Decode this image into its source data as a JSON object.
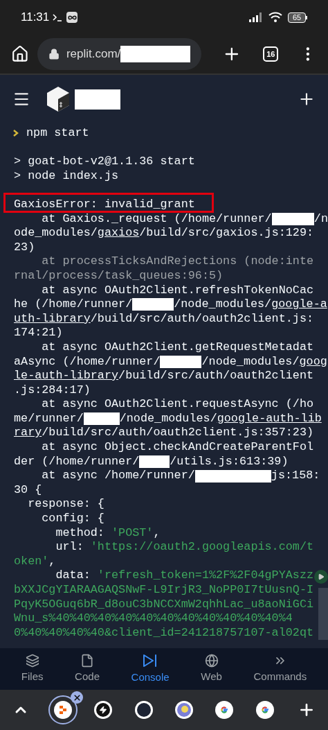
{
  "status_bar": {
    "time": "11:31",
    "battery": "65"
  },
  "browser": {
    "url": "replit.com/",
    "tab_count": "16"
  },
  "console": {
    "blocks": [
      {
        "lines": [
          {
            "kind": "prompt",
            "segments": [
              {
                "kind": "text",
                "text": "npm start"
              }
            ]
          }
        ]
      },
      {
        "lines": [
          {
            "kind": "output",
            "segments": [
              {
                "kind": "text",
                "text": "> goat-bot-v2@1.1.36 start"
              }
            ]
          },
          {
            "kind": "output",
            "segments": [
              {
                "kind": "text",
                "text": "> node index.js"
              }
            ]
          }
        ]
      },
      {
        "lines": [
          {
            "kind": "output",
            "highlighted": true,
            "segments": [
              {
                "kind": "text",
                "text": "GaxiosError: invalid_grant"
              }
            ]
          },
          {
            "kind": "output",
            "segments": [
              {
                "kind": "text",
                "text": "    at Gaxios._request (/home/runner/"
              },
              {
                "kind": "redacted"
              },
              {
                "kind": "text",
                "text": "/n"
              }
            ]
          },
          {
            "kind": "output",
            "segments": [
              {
                "kind": "text",
                "text": "ode_modules/"
              },
              {
                "kind": "link",
                "text": "gaxios"
              },
              {
                "kind": "text",
                "text": "/build/src/gaxios.js:129:"
              }
            ]
          },
          {
            "kind": "output",
            "segments": [
              {
                "kind": "text",
                "text": "23)"
              }
            ]
          },
          {
            "kind": "output",
            "segments": [
              {
                "kind": "dim",
                "text": "    at processTicksAndRejections (node:inte"
              }
            ]
          },
          {
            "kind": "output",
            "segments": [
              {
                "kind": "dim",
                "text": "rnal/process/task_queues:96:5)"
              }
            ]
          },
          {
            "kind": "output",
            "segments": [
              {
                "kind": "text",
                "text": "    at async OAuth2Client.refreshTokenNoCac"
              }
            ]
          },
          {
            "kind": "output",
            "segments": [
              {
                "kind": "text",
                "text": "he (/home/runner/"
              },
              {
                "kind": "redacted"
              },
              {
                "kind": "text",
                "text": "/node_modules/"
              },
              {
                "kind": "link",
                "text": "google-a"
              }
            ]
          },
          {
            "kind": "output",
            "segments": [
              {
                "kind": "link",
                "text": "uth-library"
              },
              {
                "kind": "text",
                "text": "/build/src/auth/oauth2client.js:"
              }
            ]
          },
          {
            "kind": "output",
            "segments": [
              {
                "kind": "text",
                "text": "174:21)"
              }
            ]
          },
          {
            "kind": "output",
            "segments": [
              {
                "kind": "text",
                "text": "    at async OAuth2Client.getRequestMetadat"
              }
            ]
          },
          {
            "kind": "output",
            "segments": [
              {
                "kind": "text",
                "text": "aAsync (/home/runner/"
              },
              {
                "kind": "redacted"
              },
              {
                "kind": "text",
                "text": "/node_modules/"
              },
              {
                "kind": "link",
                "text": "goog"
              }
            ]
          },
          {
            "kind": "output",
            "segments": [
              {
                "kind": "link",
                "text": "le-auth-library"
              },
              {
                "kind": "text",
                "text": "/build/src/auth/oauth2client"
              }
            ]
          },
          {
            "kind": "output",
            "segments": [
              {
                "kind": "text",
                "text": ".js:284:17)"
              }
            ]
          },
          {
            "kind": "output",
            "segments": [
              {
                "kind": "text",
                "text": "    at async OAuth2Client.requestAsync (/ho"
              }
            ]
          },
          {
            "kind": "output",
            "segments": [
              {
                "kind": "text",
                "text": "me/runner/"
              },
              {
                "kind": "redacted"
              },
              {
                "kind": "text",
                "text": "/node_modules/"
              },
              {
                "kind": "link",
                "text": "google-auth-lib"
              }
            ]
          },
          {
            "kind": "output",
            "segments": [
              {
                "kind": "link",
                "text": "rary"
              },
              {
                "kind": "text",
                "text": "/build/src/auth/oauth2client.js:357:23)"
              }
            ]
          },
          {
            "kind": "output",
            "segments": [
              {
                "kind": "text",
                "text": "    at async Object.checkAndCreateParentFol"
              }
            ]
          },
          {
            "kind": "output",
            "segments": [
              {
                "kind": "text",
                "text": "der (/home/runner/"
              },
              {
                "kind": "redacted"
              },
              {
                "kind": "text",
                "text": "/utils.js:613:39)"
              }
            ]
          },
          {
            "kind": "output",
            "segments": [
              {
                "kind": "text",
                "text": "    at async /home/runner/"
              },
              {
                "kind": "redacted"
              },
              {
                "kind": "text",
                "text": "js:158:"
              }
            ]
          },
          {
            "kind": "output",
            "segments": [
              {
                "kind": "text",
                "text": "30 {"
              }
            ]
          },
          {
            "kind": "output",
            "segments": [
              {
                "kind": "text",
                "text": "  response: {"
              }
            ]
          },
          {
            "kind": "output",
            "segments": [
              {
                "kind": "text",
                "text": "    config: {"
              }
            ]
          },
          {
            "kind": "output",
            "segments": [
              {
                "kind": "text",
                "text": "      method: "
              },
              {
                "kind": "string",
                "text": "'POST'"
              },
              {
                "kind": "text",
                "text": ","
              }
            ]
          },
          {
            "kind": "output",
            "segments": [
              {
                "kind": "text",
                "text": "      url: "
              },
              {
                "kind": "string",
                "text": "'https://oauth2.googleapis.com/t"
              }
            ]
          },
          {
            "kind": "output",
            "segments": [
              {
                "kind": "string",
                "text": "oken'"
              },
              {
                "kind": "text",
                "text": ","
              }
            ]
          },
          {
            "kind": "output",
            "segments": [
              {
                "kind": "text",
                "text": "      data: "
              },
              {
                "kind": "string",
                "text": "'refresh_token=1%2F%2F04gPYAszz"
              }
            ]
          },
          {
            "kind": "output",
            "segments": [
              {
                "kind": "string",
                "text": "bXXJCgYIARAAGAQSNwF-L9IrjR3_NoPP0I7tUusnQ-I"
              }
            ]
          },
          {
            "kind": "output",
            "segments": [
              {
                "kind": "string",
                "text": "PqyK5OGuq6bR_d8ouC3bNCCXmW2qhhLac_u8aoNiGCi"
              }
            ]
          },
          {
            "kind": "output",
            "segments": [
              {
                "kind": "string",
                "text": "Wnu_s%40%40%40%40%40%40%40%40%40%40%40%4"
              }
            ]
          },
          {
            "kind": "output",
            "segments": [
              {
                "kind": "string",
                "text": "0%40%40%40%40&client_id=241218757107-al02qt"
              }
            ]
          }
        ]
      }
    ]
  },
  "nav_tabs": [
    {
      "label": "Files",
      "selected": false
    },
    {
      "label": "Code",
      "selected": false
    },
    {
      "label": "Console",
      "selected": true
    },
    {
      "label": "Web",
      "selected": false
    },
    {
      "label": "Commands",
      "selected": false
    }
  ],
  "app_tabs": [
    {
      "selected": true
    },
    {
      "selected": false
    },
    {
      "selected": false
    },
    {
      "selected": false
    },
    {
      "selected": false
    },
    {
      "selected": false
    }
  ]
}
